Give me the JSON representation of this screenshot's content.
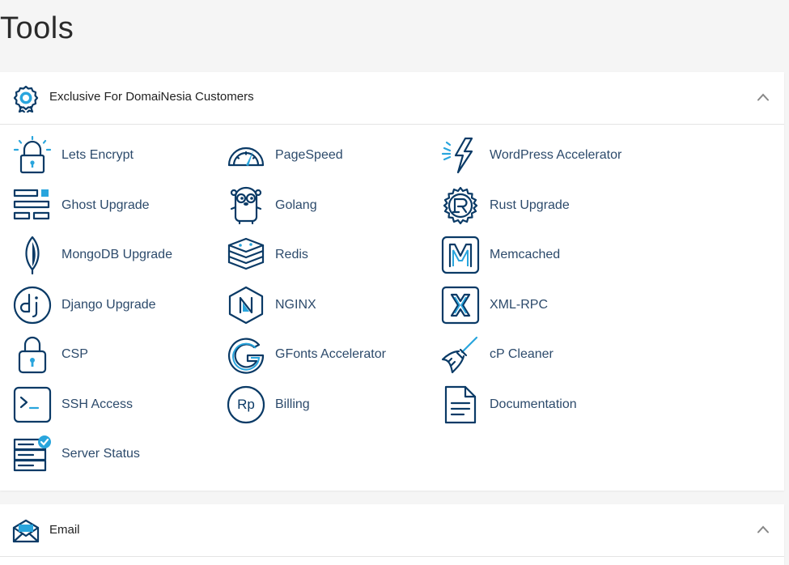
{
  "page": {
    "title": "Tools"
  },
  "colors": {
    "icon_primary": "#0a3a66",
    "icon_accent": "#29a5dd",
    "link_text": "#2c4a6b"
  },
  "sections": [
    {
      "title": "Exclusive For DomaiNesia Customers",
      "icon": "award-badge-icon",
      "expanded": true,
      "items": [
        {
          "label": "Lets Encrypt",
          "icon": "lock-icon"
        },
        {
          "label": "PageSpeed",
          "icon": "speedometer-icon"
        },
        {
          "label": "WordPress Accelerator",
          "icon": "lightning-icon"
        },
        {
          "label": "Ghost Upgrade",
          "icon": "ghost-layout-icon"
        },
        {
          "label": "Golang",
          "icon": "gopher-icon"
        },
        {
          "label": "Rust Upgrade",
          "icon": "rust-gear-icon"
        },
        {
          "label": "MongoDB Upgrade",
          "icon": "mongodb-leaf-icon"
        },
        {
          "label": "Redis",
          "icon": "redis-stack-icon"
        },
        {
          "label": "Memcached",
          "icon": "memcached-icon"
        },
        {
          "label": "Django Upgrade",
          "icon": "django-icon"
        },
        {
          "label": "NGINX",
          "icon": "nginx-icon"
        },
        {
          "label": "XML-RPC",
          "icon": "xml-rpc-icon"
        },
        {
          "label": "CSP",
          "icon": "padlock-icon"
        },
        {
          "label": "GFonts Accelerator",
          "icon": "google-fonts-icon"
        },
        {
          "label": "cP Cleaner",
          "icon": "broom-icon"
        },
        {
          "label": "SSH Access",
          "icon": "terminal-icon"
        },
        {
          "label": "Billing",
          "icon": "rupiah-coin-icon"
        },
        {
          "label": "Documentation",
          "icon": "document-icon"
        },
        {
          "label": "Server Status",
          "icon": "server-check-icon"
        }
      ]
    },
    {
      "title": "Email",
      "icon": "envelope-icon",
      "expanded": true,
      "items": []
    }
  ]
}
